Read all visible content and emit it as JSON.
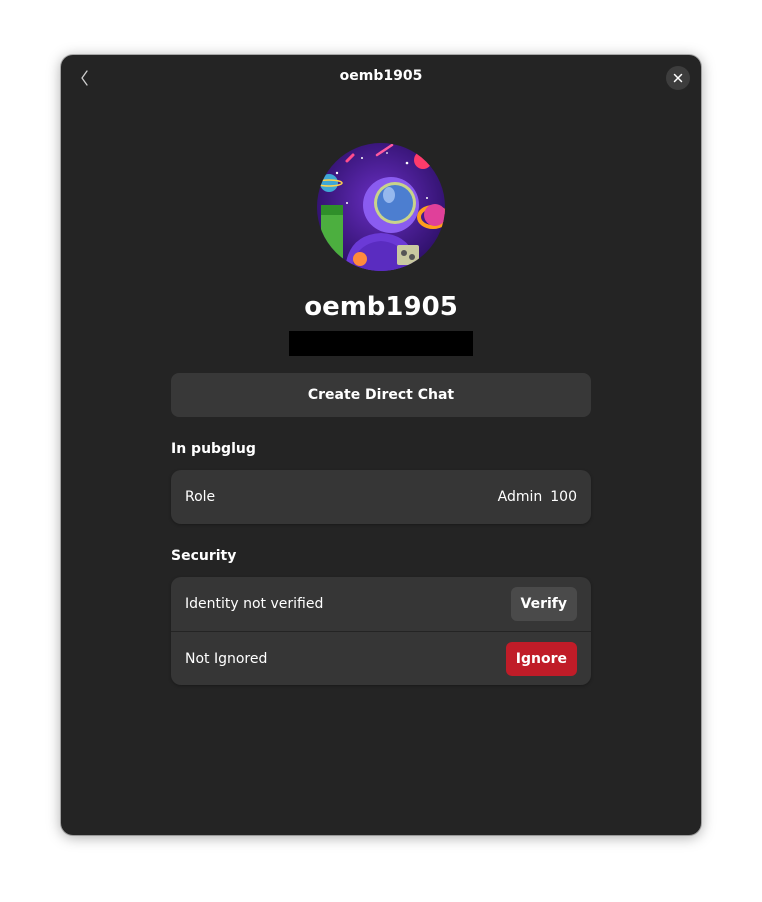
{
  "window": {
    "title": "oemb1905"
  },
  "profile": {
    "display_name": "oemb1905"
  },
  "actions": {
    "direct_chat_label": "Create Direct Chat"
  },
  "room_section": {
    "heading": "In pubglug",
    "role_label": "Role",
    "role_name": "Admin",
    "power_level": "100"
  },
  "security_section": {
    "heading": "Security",
    "identity_label": "Identity not verified",
    "verify_label": "Verify",
    "ignore_status_label": "Not Ignored",
    "ignore_label": "Ignore"
  },
  "icons": {
    "back": "chevron-left-icon",
    "close": "close-icon"
  },
  "colors": {
    "window_bg": "#242424",
    "card_bg": "#363636",
    "destructive": "#c01c28"
  }
}
